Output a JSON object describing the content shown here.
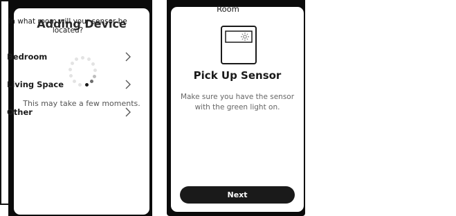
{
  "adding": {
    "title": "Adding Device",
    "message": "This may take a few moments."
  },
  "pickup": {
    "title": "Pick Up Sensor",
    "message": "Make sure you have the sensor with the green light on.",
    "next_label": "Next"
  },
  "room": {
    "title": "Room",
    "question": "In what room will your sensor be located?",
    "options": [
      {
        "label": "Bedroom",
        "icon": "chevron-right-icon"
      },
      {
        "label": "Living Space",
        "icon": "chevron-right-icon"
      },
      {
        "label": "Other",
        "icon": "chevron-right-icon"
      }
    ]
  }
}
